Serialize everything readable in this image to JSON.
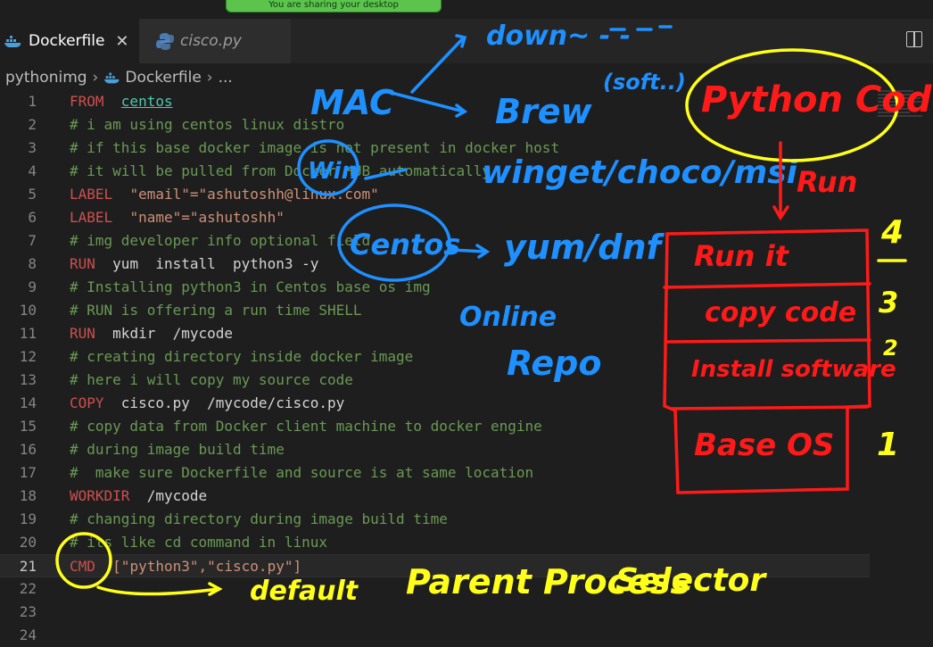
{
  "share_banner": "You are sharing your desktop",
  "tabs": [
    {
      "label": "Dockerfile",
      "active": true,
      "icon": "docker-icon"
    },
    {
      "label": "cisco.py",
      "active": false,
      "icon": "python-icon"
    }
  ],
  "breadcrumb": {
    "folder": "pythonimg",
    "file": "Dockerfile",
    "more": "..."
  },
  "code_lines": [
    {
      "n": "1",
      "kw": "FROM",
      "rest": "centos"
    },
    {
      "n": "2",
      "text": "# i am using centos linux distro"
    },
    {
      "n": "3",
      "text": "# if this base docker image is not present in docker host"
    },
    {
      "n": "4",
      "text": "# it will be pulled from Docker HUB automatically"
    },
    {
      "n": "5",
      "kw": "LABEL",
      "rest": "\"email\"=\"ashutoshh@linux.com\""
    },
    {
      "n": "6",
      "kw": "LABEL",
      "rest": "\"name\"=\"ashutoshh\""
    },
    {
      "n": "7",
      "text": "# img developer info optional field"
    },
    {
      "n": "8",
      "kw": "RUN",
      "rest": "yum  install  python3 -y"
    },
    {
      "n": "9",
      "text": "# Installing python3 in Centos base os img"
    },
    {
      "n": "10",
      "text": "# RUN is offering a run time SHELL"
    },
    {
      "n": "11",
      "kw": "RUN",
      "rest": "mkdir  /mycode"
    },
    {
      "n": "12",
      "text": "# creating directory inside docker image"
    },
    {
      "n": "13",
      "text": "# here i will copy my source code"
    },
    {
      "n": "14",
      "kw": "COPY",
      "rest": "cisco.py  /mycode/cisco.py"
    },
    {
      "n": "15",
      "text": "# copy data from Docker client machine to docker engine"
    },
    {
      "n": "16",
      "text": "# during image build time"
    },
    {
      "n": "17",
      "text": "#  make sure Dockerfile and source is at same location"
    },
    {
      "n": "18",
      "kw": "WORKDIR",
      "rest": "/mycode"
    },
    {
      "n": "19",
      "text": "# changing directory during image build time"
    },
    {
      "n": "20",
      "text": "# its like cd command in linux"
    },
    {
      "n": "21",
      "kw": "CMD",
      "rest": "[\"python3\",\"cisco.py\"]"
    },
    {
      "n": "22",
      "text": ""
    },
    {
      "n": "23",
      "text": ""
    },
    {
      "n": "24",
      "text": ""
    }
  ],
  "annotations": {
    "blue": {
      "mac": "MAC",
      "download": "down~ - -",
      "brew": "Brew",
      "software": "(soft..)",
      "win": "Win",
      "winget": "winget/choco/msi",
      "centos": "Centos",
      "yum": "yum/dnf",
      "online": "Online",
      "repo": "Repo"
    },
    "red": {
      "python_code": "Python Code",
      "run": "Run",
      "run_it": "Run it",
      "copy_code": "copy code",
      "install": "Install software",
      "base_os": "Base OS"
    },
    "yellow": {
      "default": "default",
      "parent_process": "Parent Process",
      "selector": "Selector",
      "layer_4": "4",
      "layer_3": "3",
      "layer_2": "2",
      "layer_1": "1"
    }
  },
  "colors": {
    "blue_ink": "#1e90ff",
    "red_ink": "#ff1a1a",
    "yellow_ink": "#ffff1a"
  }
}
